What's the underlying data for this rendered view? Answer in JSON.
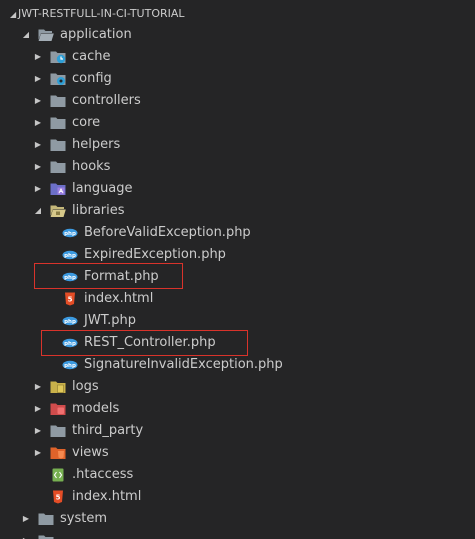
{
  "explorer": {
    "project_title": "JWT-RESTFULL-IN-CI-TUTORIAL",
    "tree": {
      "application": "application",
      "cache": "cache",
      "config": "config",
      "controllers": "controllers",
      "core": "core",
      "helpers": "helpers",
      "hooks": "hooks",
      "language": "language",
      "libraries": "libraries",
      "before_valid_exception": "BeforeValidException.php",
      "expired_exception": "ExpiredException.php",
      "format": "Format.php",
      "index_html_lib": "index.html",
      "jwt": "JWT.php",
      "rest_controller": "REST_Controller.php",
      "signature_invalid_exception": "SignatureInvalidException.php",
      "logs": "logs",
      "models": "models",
      "third_party": "third_party",
      "views": "views",
      "htaccess": ".htaccess",
      "index_html_app": "index.html",
      "system": "system"
    }
  },
  "colors": {
    "background": "#252526",
    "text": "#cccccc",
    "folder": "#8f9aa3",
    "highlight_box": "#d9332b",
    "php_icon": "#3c9ae0",
    "html_icon": "#e44d26",
    "htaccess_icon": "#77b051"
  }
}
